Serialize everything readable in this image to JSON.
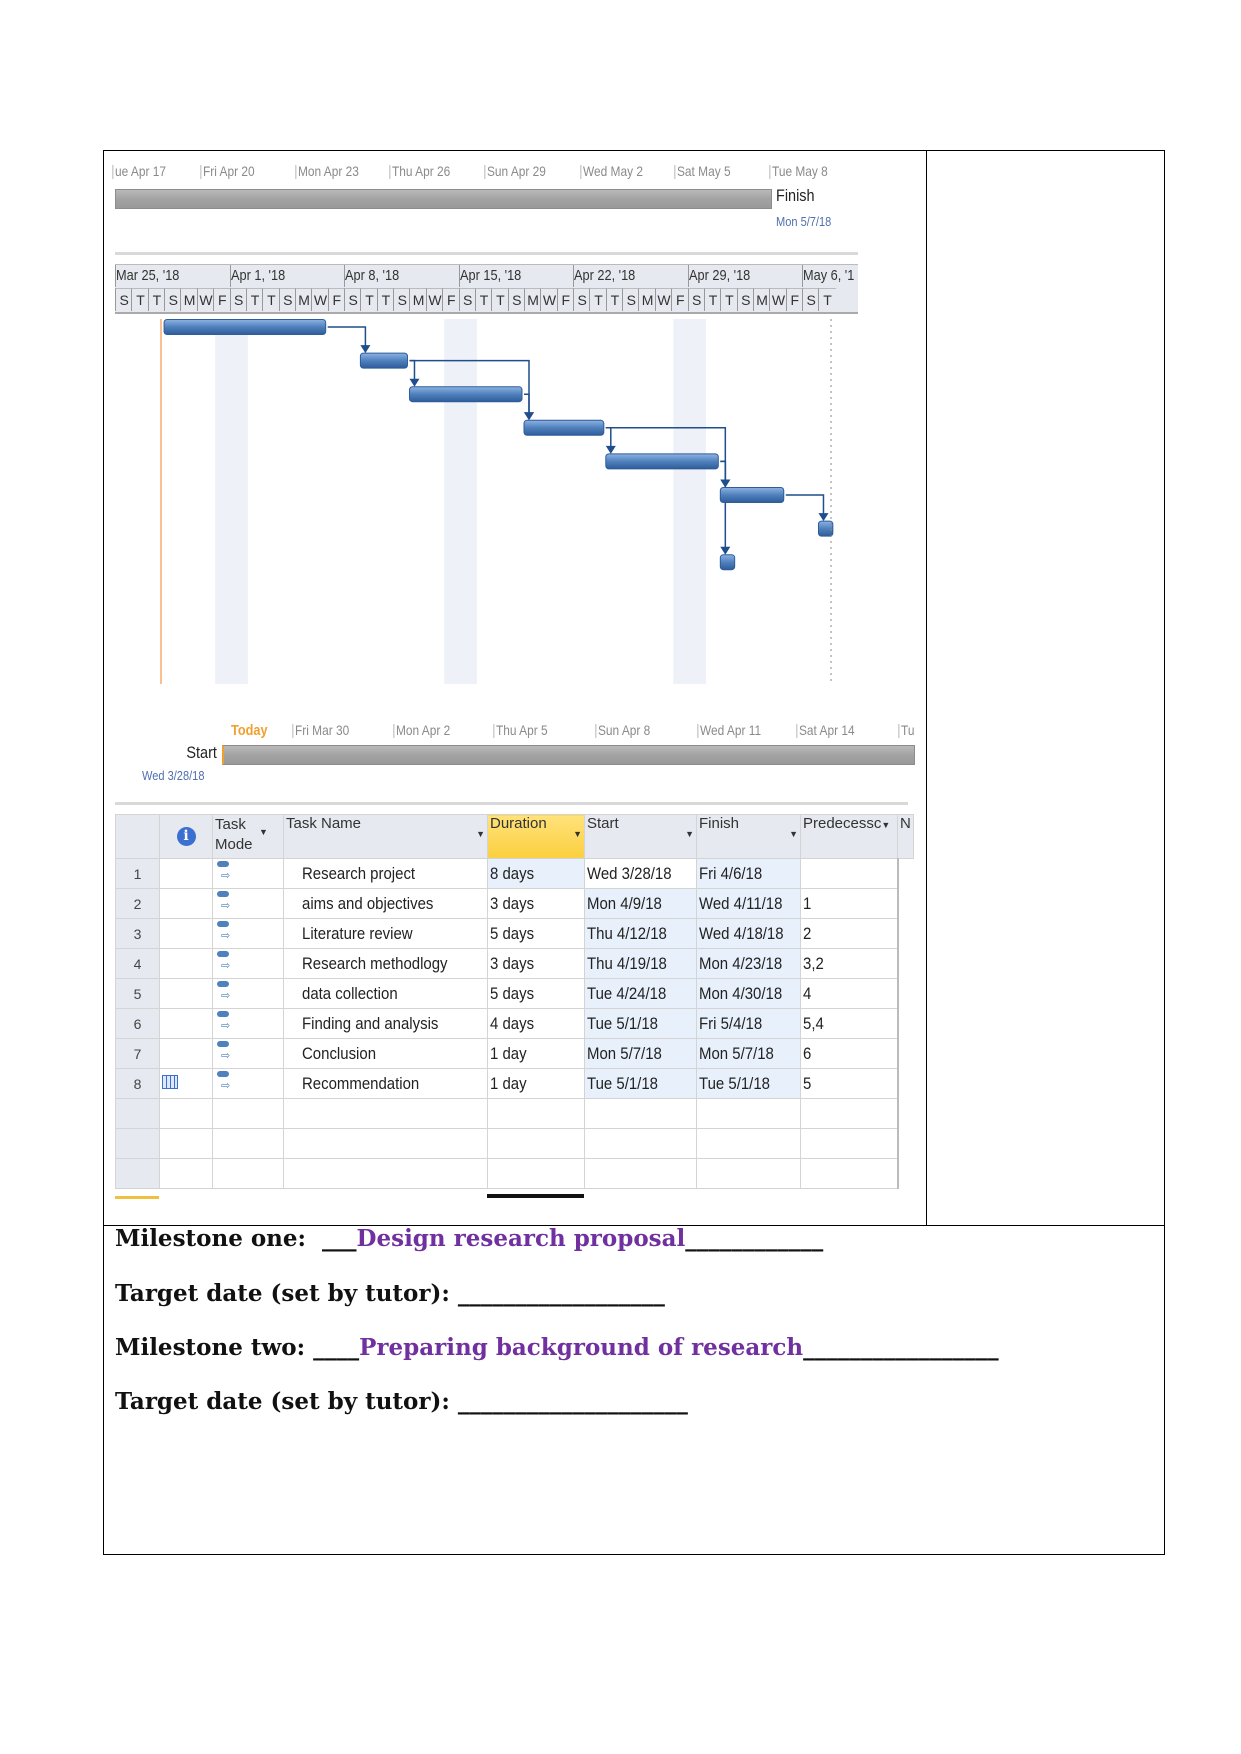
{
  "top_timeline": {
    "labels": [
      "ue Apr 17",
      "Fri Apr 20",
      "Mon Apr 23",
      "Thu Apr 26",
      "Sun Apr 29",
      "Wed May 2",
      "Sat May 5",
      "Tue May 8"
    ],
    "end_label": "Finish",
    "end_date": "Mon 5/7/18"
  },
  "timescale": {
    "weeks": [
      "Mar 25, '18",
      "Apr 1, '18",
      "Apr 8, '18",
      "Apr 15, '18",
      "Apr 22, '18",
      "Apr 29, '18",
      "May 6, '1"
    ],
    "days": [
      "S",
      "T",
      "T",
      "S",
      "M",
      "W",
      "F"
    ],
    "last_days": [
      "S",
      "T"
    ]
  },
  "bottom_timeline": {
    "today": "Today",
    "labels": [
      "Fri Mar 30",
      "Mon Apr 2",
      "Thu Apr 5",
      "Sun Apr 8",
      "Wed Apr 11",
      "Sat Apr 14",
      "Tu"
    ],
    "start_label": "Start",
    "start_date": "Wed 3/28/18"
  },
  "colors": {
    "bar": "#4f81bd",
    "today_line": "#f79646",
    "milestone_text": "#7030A0",
    "duration_header": "#fbd55a"
  },
  "table": {
    "headers": [
      "",
      "info-icon",
      "Task Mode",
      "Task Name",
      "Duration",
      "Start",
      "Finish",
      "Predecessc",
      "N"
    ],
    "rows": [
      {
        "id": "1",
        "name": "Research project",
        "duration": "8 days",
        "start": "Wed 3/28/18",
        "finish": "Fri 4/6/18",
        "pred": ""
      },
      {
        "id": "2",
        "name": "aims and objectives",
        "duration": "3 days",
        "start": "Mon 4/9/18",
        "finish": "Wed 4/11/18",
        "pred": "1"
      },
      {
        "id": "3",
        "name": "Literature review",
        "duration": "5 days",
        "start": "Thu 4/12/18",
        "finish": "Wed 4/18/18",
        "pred": "2"
      },
      {
        "id": "4",
        "name": "Research methodlogy",
        "duration": "3 days",
        "start": "Thu 4/19/18",
        "finish": "Mon 4/23/18",
        "pred": "3,2"
      },
      {
        "id": "5",
        "name": "data collection",
        "duration": "5 days",
        "start": "Tue 4/24/18",
        "finish": "Mon 4/30/18",
        "pred": "4"
      },
      {
        "id": "6",
        "name": "Finding and analysis",
        "duration": "4 days",
        "start": "Tue 5/1/18",
        "finish": "Fri 5/4/18",
        "pred": "5,4"
      },
      {
        "id": "7",
        "name": "Conclusion",
        "duration": "1 day",
        "start": "Mon 5/7/18",
        "finish": "Mon 5/7/18",
        "pred": "6"
      },
      {
        "id": "8",
        "name": "Recommendation",
        "duration": "1 day",
        "start": "Tue 5/1/18",
        "finish": "Tue 5/1/18",
        "pred": "5"
      }
    ]
  },
  "gantt_tasks": [
    {
      "start": "2018-03-28",
      "finish": "2018-04-06",
      "pred": []
    },
    {
      "start": "2018-04-09",
      "finish": "2018-04-11",
      "pred": [
        1
      ]
    },
    {
      "start": "2018-04-12",
      "finish": "2018-04-18",
      "pred": [
        2
      ]
    },
    {
      "start": "2018-04-19",
      "finish": "2018-04-23",
      "pred": [
        3,
        2
      ]
    },
    {
      "start": "2018-04-24",
      "finish": "2018-04-30",
      "pred": [
        4
      ]
    },
    {
      "start": "2018-05-01",
      "finish": "2018-05-04",
      "pred": [
        5,
        4
      ]
    },
    {
      "start": "2018-05-07",
      "finish": "2018-05-07",
      "pred": [
        6
      ]
    },
    {
      "start": "2018-05-01",
      "finish": "2018-05-01",
      "pred": [
        5
      ]
    }
  ],
  "milestones": {
    "one_label": "Milestone one:",
    "one_pre": "___",
    "one_value": "Design research proposal",
    "one_post": "____________",
    "target1_label": "Target date (set by tutor):",
    "target1_blank": "__________________",
    "two_label": "Milestone two:",
    "two_pre": "____",
    "two_value": "Preparing background of research",
    "two_post": "_________________",
    "target2_label": "Target date (set by tutor):",
    "target2_blank": "____________________"
  }
}
